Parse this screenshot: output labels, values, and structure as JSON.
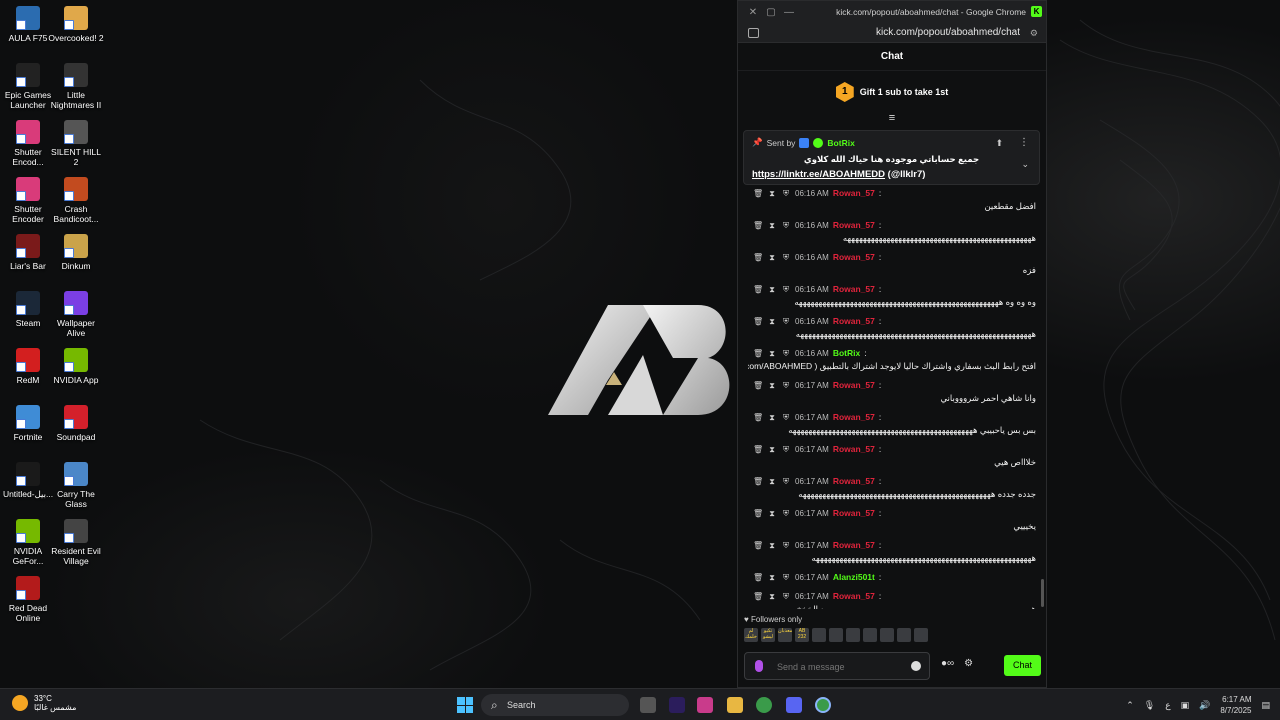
{
  "desktop": {
    "icons": [
      {
        "label": "AULA F75",
        "color": "#2b6cb0"
      },
      {
        "label": "Overcooked! 2",
        "color": "#e0a84a"
      },
      {
        "label": "Epic Games Launcher",
        "color": "#222"
      },
      {
        "label": "Little Nightmares II",
        "color": "#333"
      },
      {
        "label": "Shutter Encod...",
        "color": "#d93b7a"
      },
      {
        "label": "SILENT HILL 2",
        "color": "#555"
      },
      {
        "label": "Shutter Encoder",
        "color": "#d93b7a"
      },
      {
        "label": "Crash Bandicoot...",
        "color": "#c24b1f"
      },
      {
        "label": "Liar's Bar",
        "color": "#7a1a1a"
      },
      {
        "label": "Dinkum",
        "color": "#caa34a"
      },
      {
        "label": "Steam",
        "color": "#1b2838"
      },
      {
        "label": "Wallpaper Alive",
        "color": "#7b3fe4"
      },
      {
        "label": "RedM",
        "color": "#d31f1f"
      },
      {
        "label": "NVIDIA App",
        "color": "#76b900"
      },
      {
        "label": "Fortnite",
        "color": "#3f8cd6"
      },
      {
        "label": "Soundpad",
        "color": "#d3202b"
      },
      {
        "label": "Untitled-بيل...",
        "color": "#1a1a1a"
      },
      {
        "label": "Carry The Glass",
        "color": "#4b87c8"
      },
      {
        "label": "NVIDIA GeFor...",
        "color": "#76b900"
      },
      {
        "label": "Resident Evil Village",
        "color": "#444"
      },
      {
        "label": "Red Dead Online",
        "color": "#b31b1b"
      }
    ]
  },
  "window": {
    "title": "kick.com/popout/aboahmed/chat - Google Chrome",
    "url": "kick.com/popout/aboahmed/chat",
    "kick_letter": "K"
  },
  "chat": {
    "header": "Chat",
    "gift_num": "1",
    "gift_text": "Gift 1 sub to take 1st",
    "pinned": {
      "sent_by": "Sent by",
      "sender": "BotRix",
      "message": "جميع حساباتي موجوده هنا حياك الله كلاوي",
      "link": "https://linktr.ee/ABOAHMEDD",
      "handle": "(@llklr7)"
    },
    "messages": [
      {
        "time": "06:16 AM",
        "user": "Rowan_57",
        "user_color": "#e0243c",
        "text": "افضل مقطعين"
      },
      {
        "time": "06:16 AM",
        "user": "Rowan_57",
        "user_color": "#e0243c",
        "text": "ههههههههههههههههههههههههههههههههههههههههههههههههه"
      },
      {
        "time": "06:16 AM",
        "user": "Rowan_57",
        "user_color": "#e0243c",
        "text": "فزه"
      },
      {
        "time": "06:16 AM",
        "user": "Rowan_57",
        "user_color": "#e0243c",
        "text": "وه وه وه ههههههههههههههههههههههههههههههههههههههههههههههههههههه"
      },
      {
        "time": "06:16 AM",
        "user": "Rowan_57",
        "user_color": "#e0243c",
        "text": "ههههههههههههههههههههههههههههههههههههههههههههههههههههههههههههه"
      },
      {
        "time": "06:16 AM",
        "user": "BotRix",
        "user_color": "#53fc18",
        "text": "افتح رابط البث بسفاري واشتراك حاليا لايوجد اشتراك بالتطبيق ( https://kick.com/ABOAHMED )"
      },
      {
        "time": "06:17 AM",
        "user": "Rowan_57",
        "user_color": "#e0243c",
        "text": "وانا شاهي احمر شروووباني"
      },
      {
        "time": "06:17 AM",
        "user": "Rowan_57",
        "user_color": "#e0243c",
        "text": "بس بس ياحبيبي هههههههههههههههههههههههههههههههههههههههههههههههه"
      },
      {
        "time": "06:17 AM",
        "user": "Rowan_57",
        "user_color": "#e0243c",
        "text": "خلاااص هيي"
      },
      {
        "time": "06:17 AM",
        "user": "Rowan_57",
        "user_color": "#e0243c",
        "text": "جدده جدده هههههههههههههههههههههههههههههههههههههههههههههههههه"
      },
      {
        "time": "06:17 AM",
        "user": "Rowan_57",
        "user_color": "#e0243c",
        "text": "يخيييي"
      },
      {
        "time": "06:17 AM",
        "user": "Rowan_57",
        "user_color": "#e0243c",
        "text": "ههههههههههههههههههههههههههههههههههههههههههههههههههههههههه"
      },
      {
        "time": "06:17 AM",
        "user": "Alanzi501t",
        "user_color": "#53fc18",
        "text": ""
      },
      {
        "time": "06:17 AM",
        "user": "Rowan_57",
        "user_color": "#e0243c",
        "text": "ههههههههههههههههههههههههههههههههههههههههههههههههههههه ه الخخخ"
      }
    ],
    "followers_only": "Followers only",
    "emotes": [
      "لم خلمك",
      "تكيو ليشو",
      "معذبان",
      "AB 232",
      "",
      "",
      "",
      "",
      "",
      "",
      ""
    ],
    "input_placeholder": "Send a message",
    "send_label": "Chat"
  },
  "taskbar": {
    "temp": "33°C",
    "weather_text": "مشمس غالبًا",
    "search_label": "Search",
    "lang": "ع",
    "time": "6:17 AM",
    "date": "8/7/2025"
  },
  "colors": {
    "kick_green": "#53fc18",
    "rowan": "#e0243c"
  }
}
